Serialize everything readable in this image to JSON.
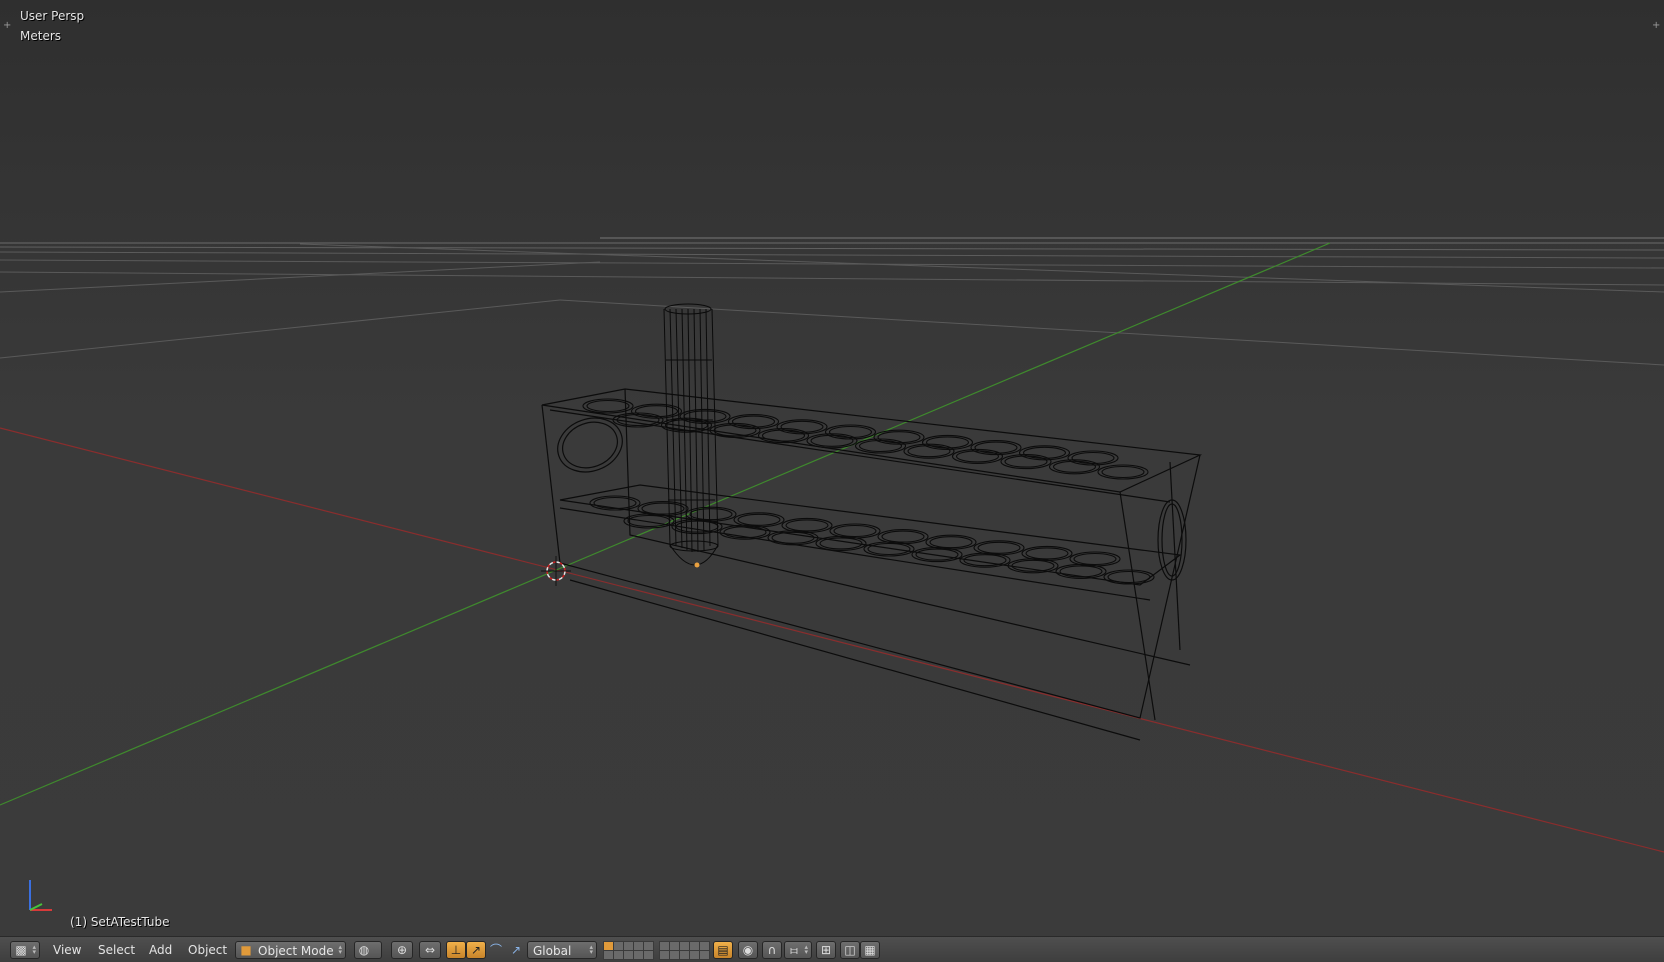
{
  "viewport": {
    "view_name": "User Persp",
    "units": "Meters",
    "object_label": "(1) SetATestTube"
  },
  "header": {
    "menus": {
      "view": "View",
      "select": "Select",
      "add": "Add",
      "object": "Object"
    },
    "mode": {
      "value": "Object Mode",
      "icon": "cube-icon"
    },
    "orientation": {
      "value": "Global"
    },
    "colors": {
      "accent": "#e09a3a",
      "background": "#393939",
      "header": "#484848"
    }
  }
}
